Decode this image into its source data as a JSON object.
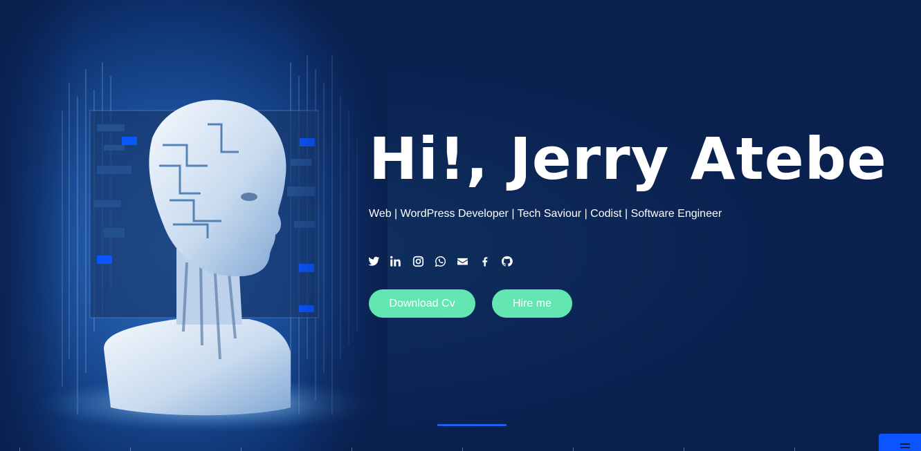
{
  "hero": {
    "title": "Hi!, Jerry Atebe",
    "subtitle": "Web | WordPress Developer | Tech Saviour | Codist | Software Engineer"
  },
  "social": [
    {
      "icon": "twitter-icon"
    },
    {
      "icon": "linkedin-icon"
    },
    {
      "icon": "instagram-icon"
    },
    {
      "icon": "whatsapp-icon"
    },
    {
      "icon": "email-icon"
    },
    {
      "icon": "facebook-icon"
    },
    {
      "icon": "github-icon"
    }
  ],
  "buttons": {
    "download_cv": "Download Cv",
    "hire_me": "Hire me"
  },
  "colors": {
    "background": "#0a2150",
    "accent_button": "#63e6b2",
    "scroll_indicator": "#1f5ff0",
    "menu_toggle": "#0a55ff"
  }
}
